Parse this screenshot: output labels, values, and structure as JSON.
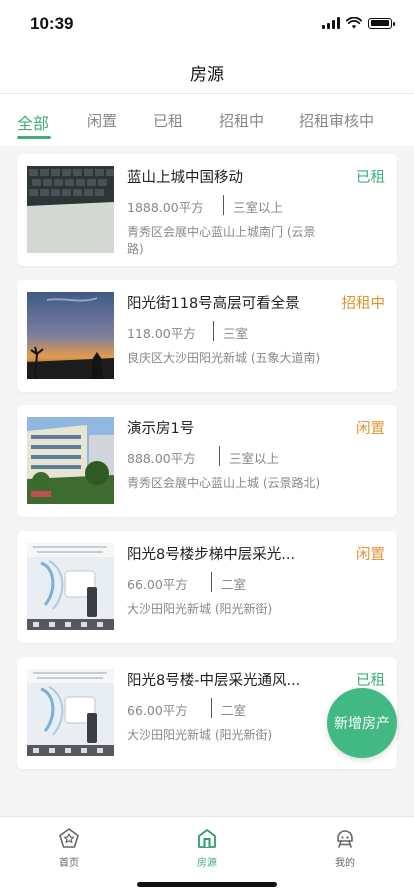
{
  "status_bar": {
    "time": "10:39"
  },
  "header": {
    "title": "房源"
  },
  "tabs": [
    {
      "label": "全部",
      "active": true
    },
    {
      "label": "闲置",
      "active": false
    },
    {
      "label": "已租",
      "active": false
    },
    {
      "label": "招租中",
      "active": false
    },
    {
      "label": "招租审核中",
      "active": false
    }
  ],
  "listings": [
    {
      "title": "蓝山上城中国移动",
      "status": "已租",
      "status_color": "#3fae7b",
      "area": "1888.00平方",
      "rooms": "三室以上",
      "address": "青秀区会展中心蓝山上城南门 (云景路)",
      "image": "keyboard-photo"
    },
    {
      "title": "阳光街118号高层可看全景",
      "status": "招租中",
      "status_color": "#e0922f",
      "area": "118.00平方",
      "rooms": "三室",
      "address": "良庆区大沙田阳光新城 (五象大道南)",
      "image": "sunset-photo"
    },
    {
      "title": "演示房1号",
      "status": "闲置",
      "status_color": "#e0922f",
      "area": "888.00平方",
      "rooms": "三室以上",
      "address": "青秀区会展中心蓝山上城 (云景路北)",
      "image": "building-photo"
    },
    {
      "title": "阳光8号楼步梯中层采光...",
      "status": "闲置",
      "status_color": "#e0922f",
      "area": "66.00平方",
      "rooms": "二室",
      "address": "大沙田阳光新城 (阳光新街)",
      "image": "appliance-photo"
    },
    {
      "title": "阳光8号楼-中层采光通风...",
      "status": "已租",
      "status_color": "#3fae7b",
      "area": "66.00平方",
      "rooms": "二室",
      "address": "大沙田阳光新城 (阳光新街)",
      "image": "appliance-photo"
    }
  ],
  "fab": {
    "label": "新增房产"
  },
  "bottom_nav": [
    {
      "label": "首页",
      "icon": "home-icon",
      "active": false
    },
    {
      "label": "房源",
      "icon": "house-icon",
      "active": true
    },
    {
      "label": "我的",
      "icon": "profile-icon",
      "active": false
    }
  ],
  "colors": {
    "accent": "#3fae7b",
    "warning": "#e0922f",
    "fab": "#42b883"
  }
}
